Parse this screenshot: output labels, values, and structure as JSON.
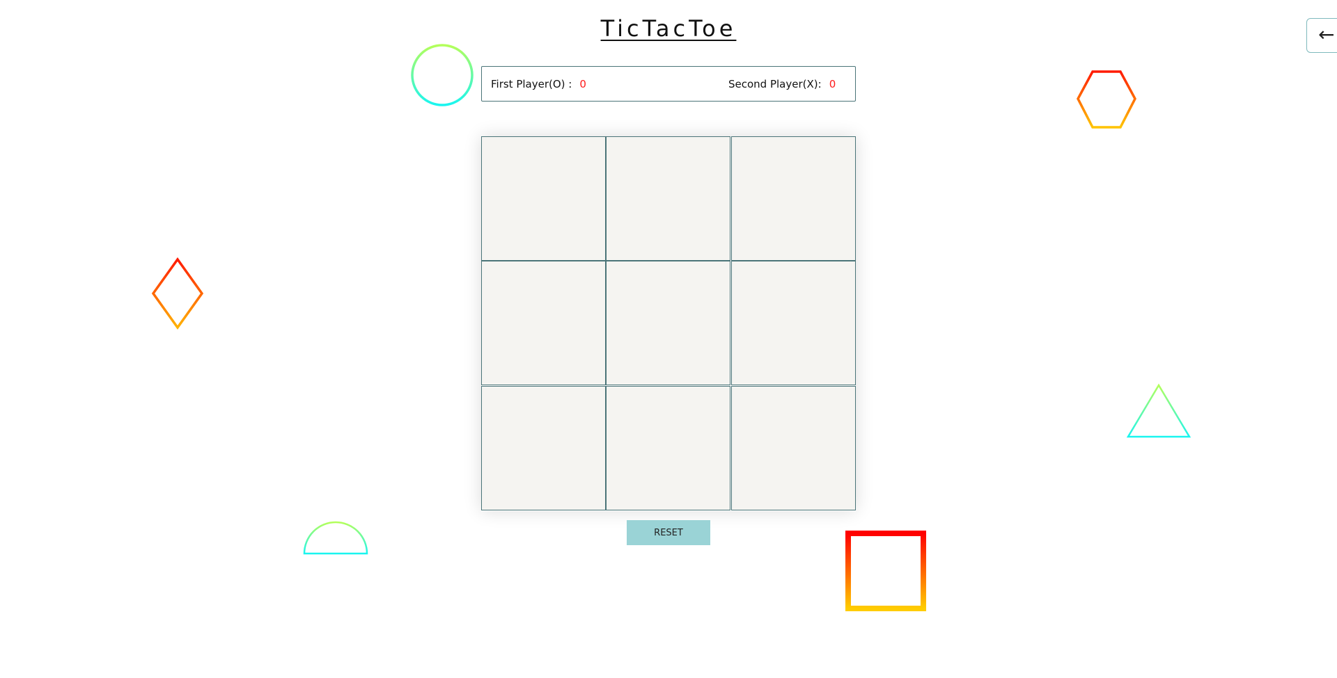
{
  "game": {
    "title": "TicTacToe"
  },
  "nav": {
    "back_glyph": "←"
  },
  "scoreboard": {
    "first_player_label": "First Player(O) :",
    "first_player_score": "0",
    "second_player_label": "Second Player(X):",
    "second_player_score": "0"
  },
  "board": {
    "cells": [
      "",
      "",
      "",
      "",
      "",
      "",
      "",
      "",
      ""
    ]
  },
  "controls": {
    "reset_label": "RESET"
  },
  "colors": {
    "score_value": "#ff1a1a",
    "cell_background": "#f5f4f1",
    "cell_border": "#4a7478",
    "reset_background": "#9ad3d6"
  },
  "decorations": [
    "circle-shape",
    "hexagon-shape",
    "diamond-shape",
    "triangle-shape",
    "semicircle-shape",
    "square-shape"
  ]
}
